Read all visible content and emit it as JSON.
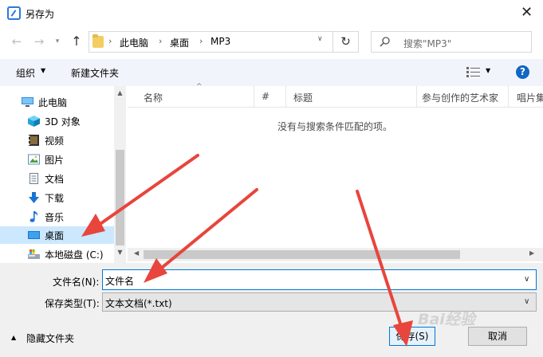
{
  "window": {
    "title": "另存为",
    "close_glyph": "✕"
  },
  "address": {
    "crumbs": [
      "此电脑",
      "桌面",
      "MP3"
    ],
    "separator": "›",
    "search_placeholder": "搜索\"MP3\""
  },
  "toolbar": {
    "organize_label": "组织",
    "new_folder_label": "新建文件夹",
    "help_label": "?"
  },
  "nav": {
    "items": [
      {
        "label": "此电脑",
        "icon": "computer-icon"
      },
      {
        "label": "3D 对象",
        "icon": "cube-icon"
      },
      {
        "label": "视频",
        "icon": "video-icon"
      },
      {
        "label": "图片",
        "icon": "picture-icon"
      },
      {
        "label": "文档",
        "icon": "document-icon"
      },
      {
        "label": "下载",
        "icon": "download-icon"
      },
      {
        "label": "音乐",
        "icon": "music-icon"
      },
      {
        "label": "桌面",
        "icon": "desktop-icon",
        "selected": true
      },
      {
        "label": "本地磁盘 (C:)",
        "icon": "drive-icon"
      }
    ]
  },
  "content": {
    "columns": [
      "名称",
      "#",
      "标题",
      "参与创作的艺术家",
      "唱片集"
    ],
    "empty_message": "没有与搜索条件匹配的项。"
  },
  "form": {
    "filename_label": "文件名(N):",
    "filename_value": "文件名",
    "filetype_label": "保存类型(T):",
    "filetype_value": "文本文档(*.txt)",
    "hide_folders_label": "隐藏文件夹",
    "save_label": "保存(S)",
    "cancel_label": "取消"
  },
  "watermark": "Bai经验",
  "colors": {
    "accent": "#0078d7",
    "arrow": "#e8453c",
    "selection": "#cce8ff",
    "toolbar_bg": "#f1f5fb"
  }
}
